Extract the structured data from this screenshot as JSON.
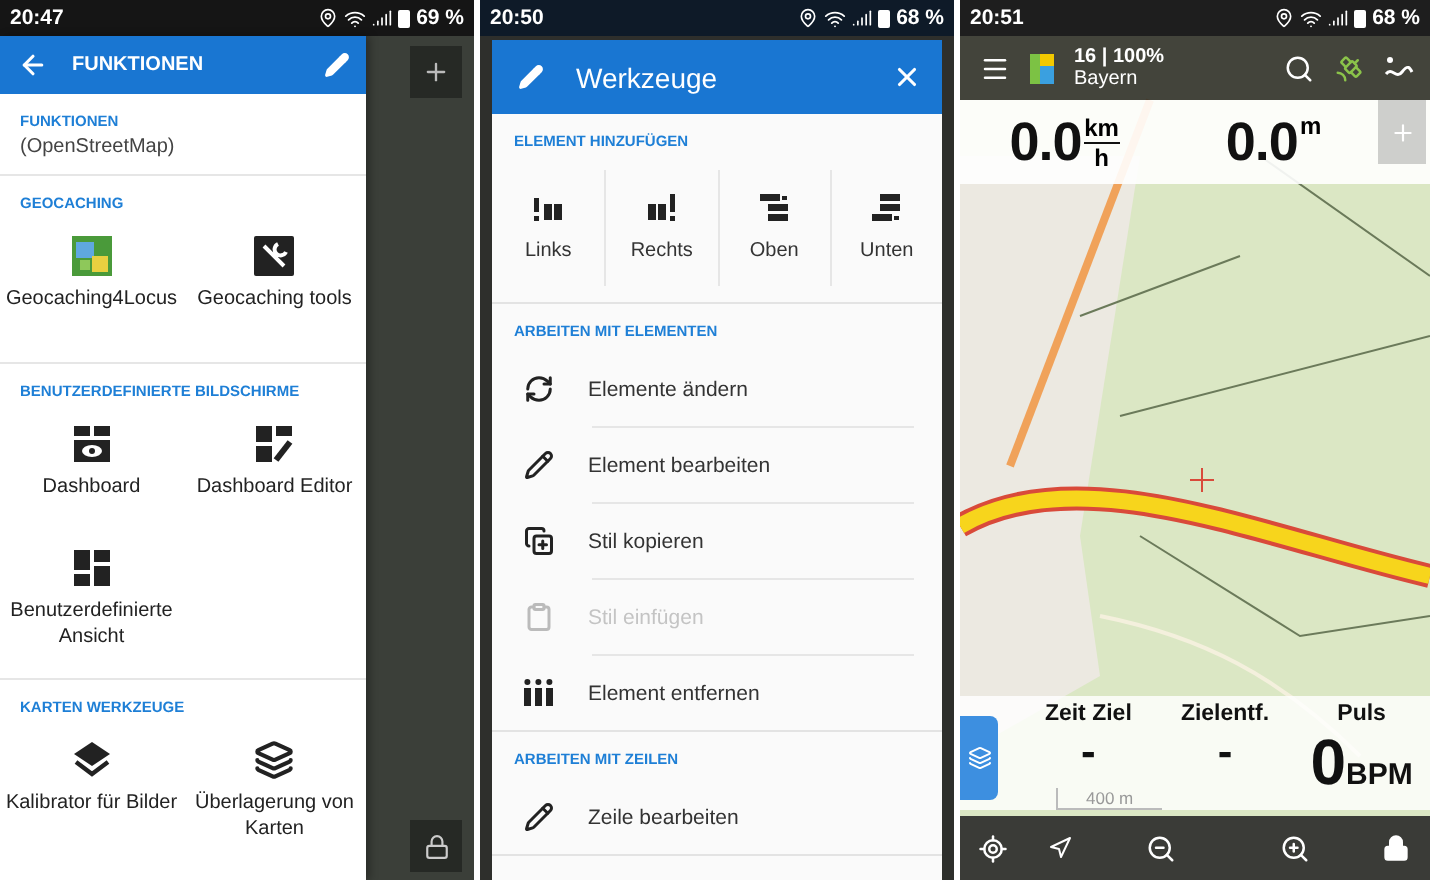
{
  "functions_screen": {
    "status_bar": {
      "time": "20:47",
      "battery": "69 %"
    },
    "app_bar": {
      "title": "FUNKTIONEN"
    },
    "sections": [
      {
        "header": "FUNKTIONEN",
        "text": "(OpenStreetMap)"
      },
      {
        "header": "GEOCACHING",
        "items": [
          {
            "label": "Geocaching4Locus"
          },
          {
            "label": "Geocaching tools"
          }
        ]
      },
      {
        "header": "BENUTZERDEFINIERTE BILDSCHIRME",
        "items": [
          {
            "label": "Dashboard"
          },
          {
            "label": "Dashboard Editor"
          },
          {
            "label": "Benutzerdefinierte Ansicht"
          }
        ]
      },
      {
        "header": "KARTEN WERKZEUGE",
        "items": [
          {
            "label": "Kalibrator für Bilder"
          },
          {
            "label": "Überlagerung von Karten"
          }
        ]
      }
    ]
  },
  "tools_screen": {
    "status_bar": {
      "time": "20:50",
      "battery": "68 %"
    },
    "dialog": {
      "title": "Werkzeuge",
      "sections": [
        {
          "header": "ELEMENT HINZUFÜGEN",
          "kind": "grid",
          "items": [
            {
              "label": "Links",
              "disabled": false
            },
            {
              "label": "Rechts",
              "disabled": false
            },
            {
              "label": "Oben",
              "disabled": false
            },
            {
              "label": "Unten",
              "disabled": false
            }
          ]
        },
        {
          "header": "ARBEITEN MIT ELEMENTEN",
          "kind": "list",
          "items": [
            {
              "label": "Elemente ändern",
              "disabled": false
            },
            {
              "label": "Element bearbeiten",
              "disabled": false
            },
            {
              "label": "Stil kopieren",
              "disabled": false
            },
            {
              "label": "Stil einfügen",
              "disabled": true
            },
            {
              "label": "Element entfernen",
              "disabled": false
            }
          ]
        },
        {
          "header": "ARBEITEN MIT ZEILEN",
          "kind": "list",
          "items": [
            {
              "label": "Zeile bearbeiten",
              "disabled": false
            }
          ]
        }
      ]
    }
  },
  "map_screen": {
    "status_bar": {
      "time": "20:51",
      "battery": "68 %"
    },
    "top_bar": {
      "zoom_info": "16 | 100%",
      "region": "Bayern"
    },
    "speed": {
      "value": "0.0",
      "unit_top": "km",
      "unit_bottom": "h"
    },
    "altitude": {
      "value": "0.0",
      "unit": "m"
    },
    "dashboard": [
      {
        "label": "Zeit Ziel",
        "value": "-"
      },
      {
        "label": "Zielentf.",
        "value": "-"
      },
      {
        "label": "Puls",
        "value": "0",
        "unit": "BPM"
      }
    ],
    "scale": "400 m"
  }
}
